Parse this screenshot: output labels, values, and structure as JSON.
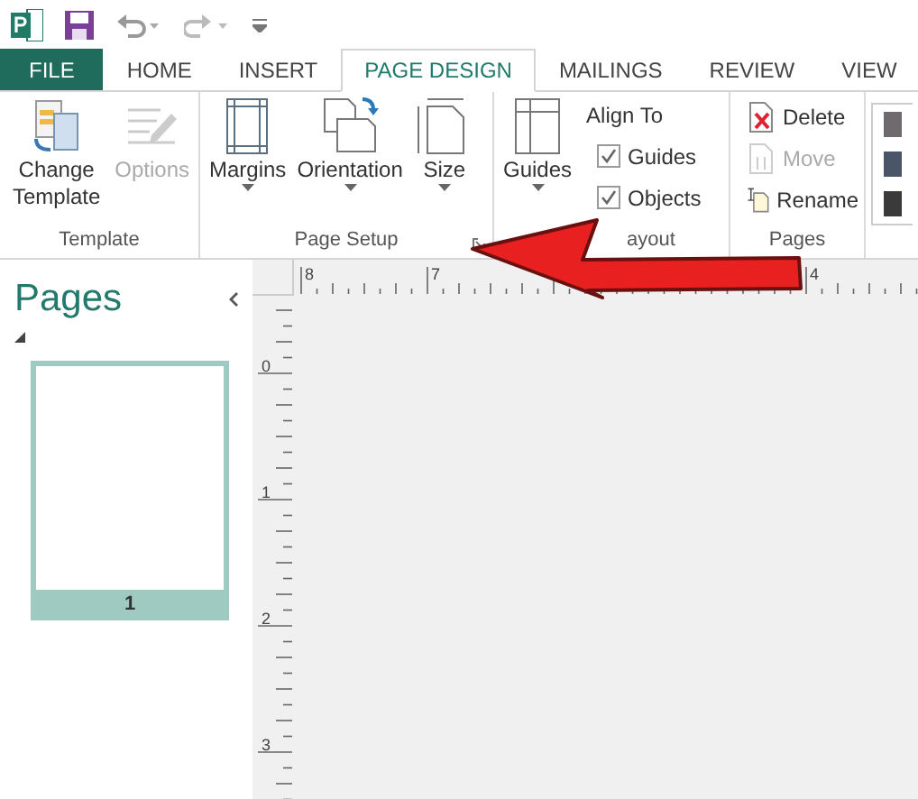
{
  "tabs": [
    {
      "label": "FILE",
      "kind": "file",
      "selected": false
    },
    {
      "label": "HOME",
      "kind": "tab",
      "selected": false
    },
    {
      "label": "INSERT",
      "kind": "tab",
      "selected": false
    },
    {
      "label": "PAGE DESIGN",
      "kind": "tab",
      "selected": true
    },
    {
      "label": "MAILINGS",
      "kind": "tab",
      "selected": false
    },
    {
      "label": "REVIEW",
      "kind": "tab",
      "selected": false
    },
    {
      "label": "VIEW",
      "kind": "tab",
      "selected": false
    }
  ],
  "ribbon_groups": [
    {
      "kind": "template",
      "label": "Template",
      "items": [
        {
          "label": "Change Template",
          "disabled": false,
          "has_menu": false
        },
        {
          "label": "Options",
          "disabled": true,
          "has_menu": false
        }
      ]
    },
    {
      "kind": "page_setup",
      "label": "Page Setup",
      "launcher": true,
      "items": [
        {
          "label": "Margins",
          "disabled": false,
          "has_menu": true
        },
        {
          "label": "Orientation",
          "disabled": false,
          "has_menu": true
        },
        {
          "label": "Size",
          "disabled": false,
          "has_menu": true
        }
      ]
    },
    {
      "kind": "layout",
      "label": "ayout",
      "items": [
        {
          "label": "Guides",
          "disabled": false,
          "has_menu": true
        }
      ],
      "align_to": {
        "title": "Align To",
        "options": [
          {
            "label": "Guides",
            "checked": true
          },
          {
            "label": "Objects",
            "checked": true
          }
        ]
      }
    },
    {
      "kind": "pages",
      "label": "Pages",
      "items": [
        {
          "label": "Delete",
          "disabled": false
        },
        {
          "label": "Move",
          "disabled": true
        },
        {
          "label": "Rename",
          "disabled": false
        }
      ]
    },
    {
      "kind": "schemes",
      "swatches": [
        {
          "color": "#6e6a6e"
        },
        {
          "color": "#4a5668"
        },
        {
          "color": "#3a3a3a"
        }
      ]
    }
  ],
  "pages_pane": {
    "title": "Pages",
    "pages": [
      {
        "number": "1",
        "selected": true
      }
    ]
  },
  "horizontal_ruler": {
    "labels": [
      {
        "label": "8"
      },
      {
        "label": "7"
      },
      {
        "label": "4"
      }
    ]
  },
  "vertical_ruler": {
    "labels": [
      {
        "label": "0"
      },
      {
        "label": "1"
      },
      {
        "label": "2"
      },
      {
        "label": "3"
      }
    ]
  }
}
